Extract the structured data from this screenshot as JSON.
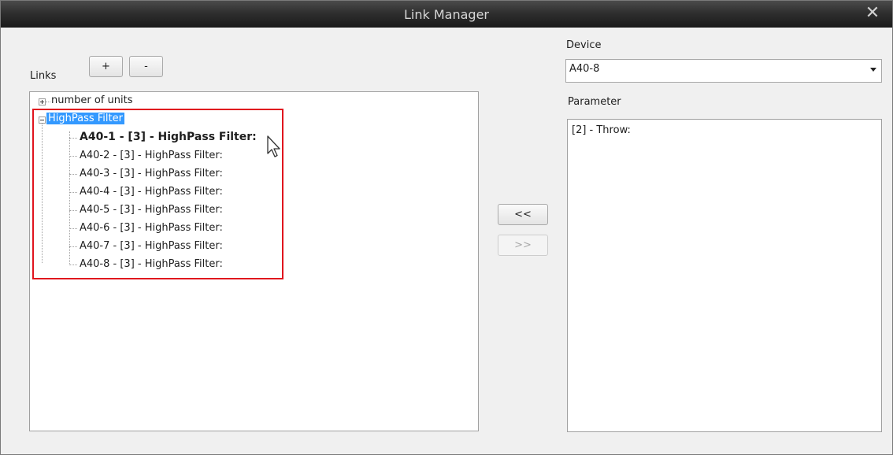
{
  "window": {
    "title": "Link Manager",
    "close_symbol": "✕"
  },
  "links": {
    "label": "Links",
    "add_label": "+",
    "remove_label": "-",
    "tree": {
      "node_units": "number of units",
      "node_filter": "HighPass Filter",
      "children": [
        "A40-1 - [3] - HighPass Filter:",
        "A40-2 - [3] - HighPass Filter:",
        "A40-3 - [3] - HighPass Filter:",
        "A40-4 - [3] - HighPass Filter:",
        "A40-5 - [3] - HighPass Filter:",
        "A40-6 - [3] - HighPass Filter:",
        "A40-7 - [3] - HighPass Filter:",
        "A40-8 - [3] - HighPass Filter:"
      ]
    }
  },
  "transfer": {
    "left_label": "<<",
    "right_label": ">>"
  },
  "device": {
    "label": "Device",
    "selected": "A40-8"
  },
  "parameter": {
    "label": "Parameter",
    "items": [
      "[2] - Throw:"
    ]
  },
  "colors": {
    "selection": "#3399ff",
    "highlight_border": "#e0141e"
  }
}
